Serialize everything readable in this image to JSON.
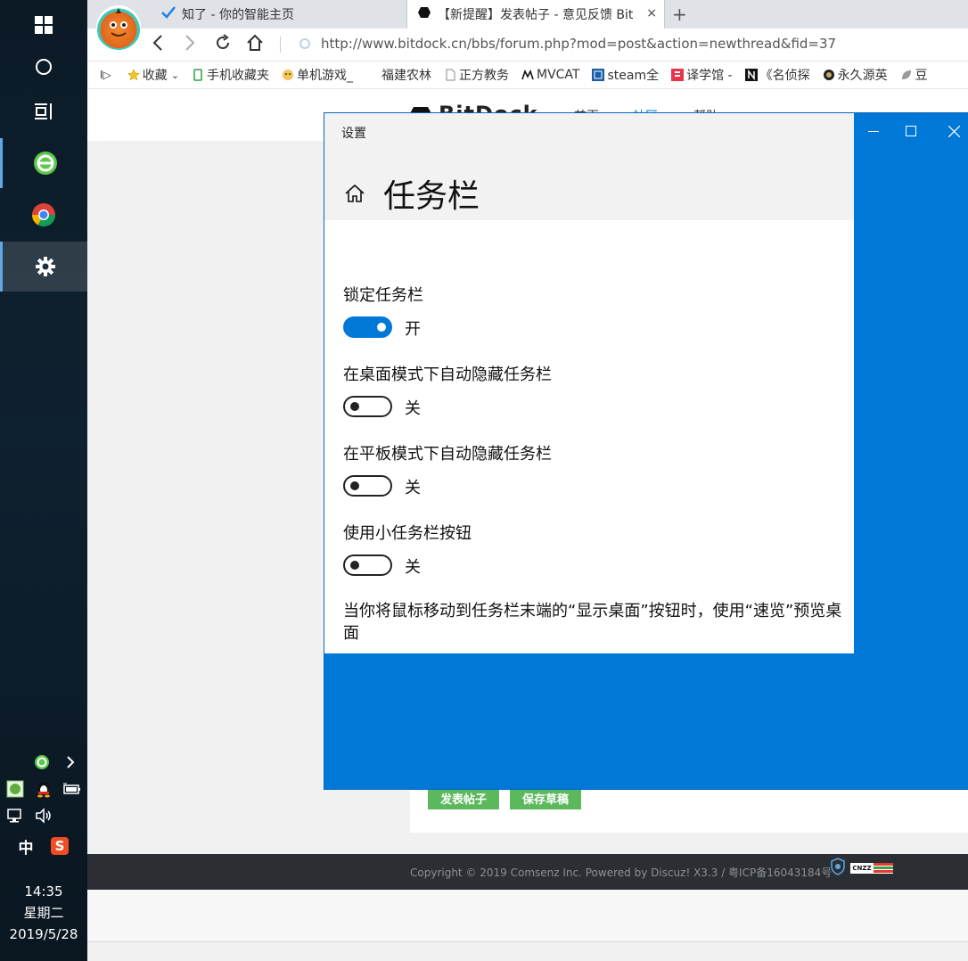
{
  "taskbar": {
    "clock_time": "14:35",
    "clock_day": "星期二",
    "clock_date": "2019/5/28",
    "ime": "中",
    "sogou": "S"
  },
  "browser": {
    "tabs": [
      {
        "label": "知了 - 你的智能主页",
        "icon": "check-icon"
      },
      {
        "label": "【新提醒】发表帖子 - 意见反馈 Bit",
        "icon": "bitdock-icon",
        "close": "×"
      }
    ],
    "new_tab": "+",
    "url": "http://www.bitdock.cn/bbs/forum.php?mod=post&action=newthread&fid=37",
    "bookmarks_toggle": "I▷",
    "bookmarks": [
      {
        "label": "收藏",
        "icon": "star-icon",
        "suffix": "⌄"
      },
      {
        "label": "手机收藏夹",
        "icon": "phone-icon"
      },
      {
        "label": "单机游戏_",
        "icon": "game-icon"
      },
      {
        "label": "福建农林",
        "icon": "blank-icon"
      },
      {
        "label": "正方教务",
        "icon": "page-icon"
      },
      {
        "label": "MVCAT",
        "icon": "mvcat-icon"
      },
      {
        "label": "steam全",
        "icon": "steam-icon"
      },
      {
        "label": "译学馆 -",
        "icon": "yixue-icon"
      },
      {
        "label": "《名侦探",
        "icon": "notion-icon"
      },
      {
        "label": "永久源英",
        "icon": "league-icon"
      },
      {
        "label": "豆",
        "icon": "leaf-icon"
      }
    ]
  },
  "site": {
    "logo": "BitDock",
    "nav": [
      "首页",
      "社区",
      "帮助"
    ],
    "post_button": "发表帖子",
    "draft_button": "保存草稿",
    "footer": "Copyright © 2019 Comsenz Inc. Powered by Discuz! X3.3 / 粤ICP备16043184号",
    "cnzz": "CNZZ"
  },
  "settings": {
    "window_title": "设置",
    "page_title": "任务栏",
    "items": [
      {
        "label": "锁定任务栏",
        "state": "开",
        "on": true
      },
      {
        "label": "在桌面模式下自动隐藏任务栏",
        "state": "关",
        "on": false
      },
      {
        "label": "在平板模式下自动隐藏任务栏",
        "state": "关",
        "on": false
      },
      {
        "label": "使用小任务栏按钮",
        "state": "关",
        "on": false
      }
    ],
    "peek_description": "当你将鼠标移动到任务栏末端的“显示桌面”按钮时，使用“速览”预览桌面"
  },
  "colors": {
    "accent": "#0078d7",
    "taskbar": "#0e2130",
    "green_button": "#5cb85c"
  }
}
